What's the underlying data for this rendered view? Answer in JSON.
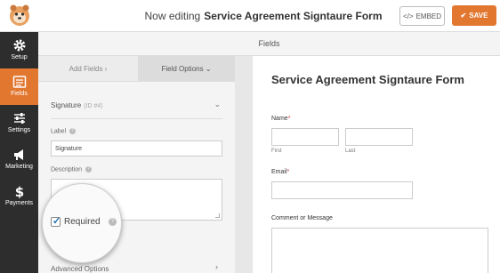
{
  "header": {
    "editing_prefix": "Now editing",
    "form_name": "Service Agreement Signtaure Form",
    "embed_label": "EMBED",
    "save_label": "SAVE"
  },
  "sidebar": {
    "items": [
      {
        "label": "Setup",
        "icon": "gear-icon"
      },
      {
        "label": "Fields",
        "icon": "fields-list-icon",
        "active": true
      },
      {
        "label": "Settings",
        "icon": "sliders-icon"
      },
      {
        "label": "Marketing",
        "icon": "megaphone-icon"
      },
      {
        "label": "Payments",
        "icon": "dollar-icon"
      }
    ]
  },
  "panel": {
    "title": "Fields",
    "tab_add": "Add Fields",
    "tab_options": "Field Options"
  },
  "field_options": {
    "field_name": "Signature",
    "field_id": "(ID #4)",
    "label_caption": "Label",
    "label_value": "Signature",
    "description_caption": "Description",
    "required_label": "Required",
    "required_checked": true,
    "advanced_label": "Advanced Options"
  },
  "preview": {
    "form_title": "Service Agreement Signtaure Form",
    "name_label": "Name",
    "first_label": "First",
    "last_label": "Last",
    "email_label": "Email",
    "comment_label": "Comment or Message",
    "required_marker": "*"
  },
  "colors": {
    "accent": "#e27730",
    "sidebar_bg": "#2d2d2d",
    "required": "#d63638"
  }
}
